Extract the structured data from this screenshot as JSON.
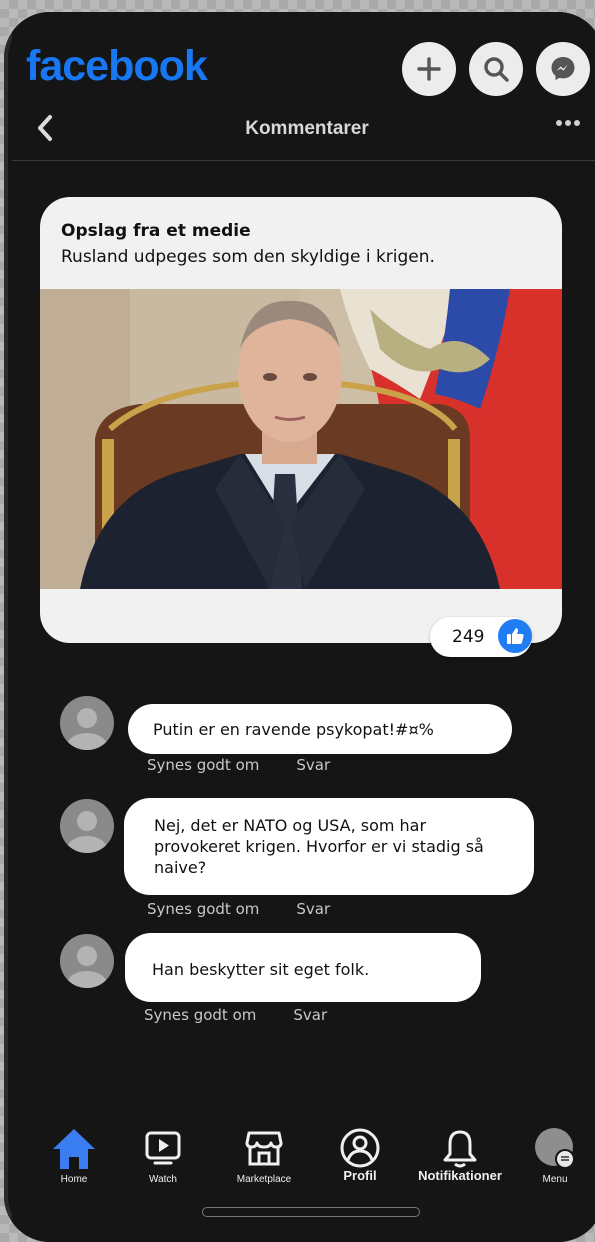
{
  "app": {
    "logo": "facebook"
  },
  "header": {
    "title": "Kommentarer"
  },
  "post": {
    "heading": "Opslag fra et medie",
    "text": "Rusland udpeges som den skyldige i krigen.",
    "like_count": "249"
  },
  "comments": [
    {
      "text": "Putin er en ravende psykopat!#¤%",
      "like_label": "Synes godt om",
      "reply_label": "Svar"
    },
    {
      "text": "Nej, det er NATO og USA, som har provokeret krigen. Hvorfor er vi stadig så naive?",
      "like_label": "Synes godt om",
      "reply_label": "Svar"
    },
    {
      "text": "Han beskytter sit eget folk.",
      "like_label": "Synes godt om",
      "reply_label": "Svar"
    }
  ],
  "tabs": [
    {
      "label": "Home",
      "icon": "home-icon"
    },
    {
      "label": "Watch",
      "icon": "video-icon"
    },
    {
      "label": "Marketplace",
      "icon": "store-icon"
    },
    {
      "label": "Profil",
      "icon": "profile-icon"
    },
    {
      "label": "Notifikationer",
      "icon": "bell-icon"
    },
    {
      "label": "Menu",
      "icon": "menu-avatar-icon"
    }
  ],
  "colors": {
    "brand": "#1877f2",
    "background": "#151515",
    "like": "#1f7cf2"
  }
}
